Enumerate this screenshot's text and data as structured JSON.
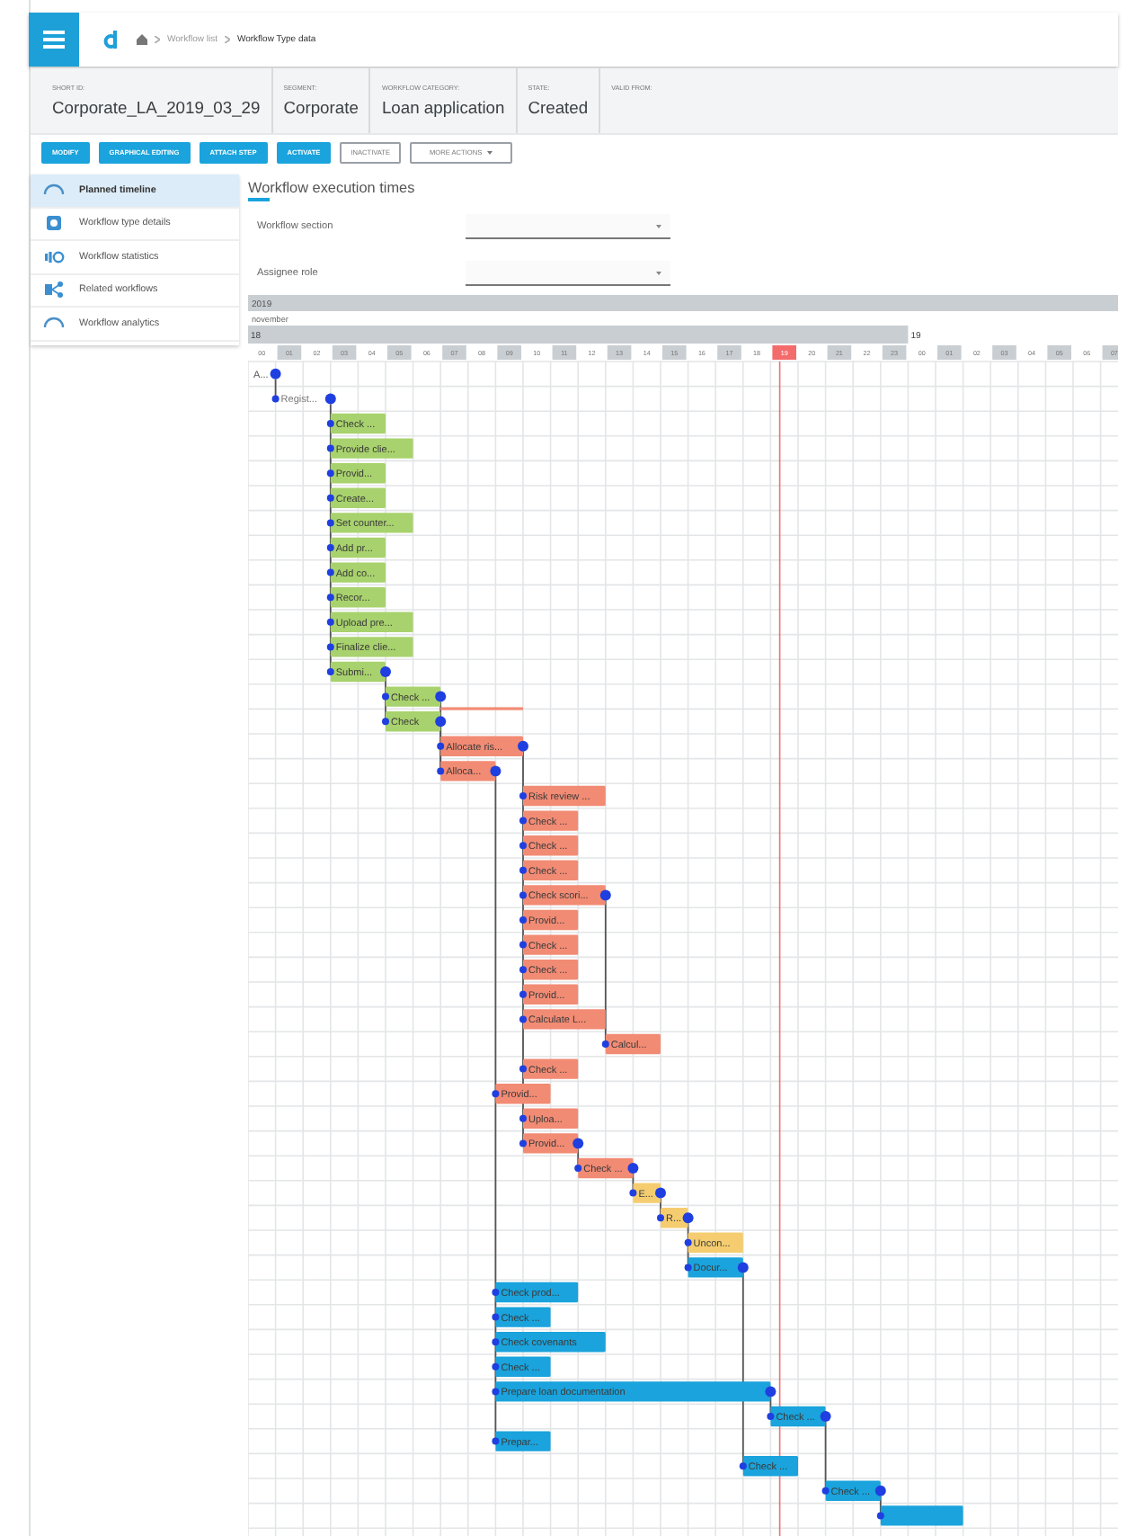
{
  "topbar": {
    "breadcrumb": [
      "Workflow list",
      "Workflow Type data"
    ]
  },
  "details": [
    {
      "label": "SHORT ID:",
      "value": "Corporate_LA_2019_03_29"
    },
    {
      "label": "SEGMENT:",
      "value": "Corporate"
    },
    {
      "label": "WORKFLOW CATEGORY:",
      "value": "Loan application"
    },
    {
      "label": "STATE:",
      "value": "Created"
    },
    {
      "label": "VALID FROM:"
    }
  ],
  "actions": [
    {
      "label": "MODIFY",
      "kind": "primary"
    },
    {
      "label": "GRAPHICAL EDITING",
      "kind": "primary"
    },
    {
      "label": "ATTACH STEP",
      "kind": "primary"
    },
    {
      "label": "ACTIVATE",
      "kind": "primary"
    },
    {
      "label": "INACTIVATE",
      "kind": "outline"
    },
    {
      "label": "MORE ACTIONS",
      "kind": "dropdown"
    }
  ],
  "sidebar": {
    "items": [
      {
        "label": "Planned timeline",
        "selected": true
      },
      {
        "label": "Workflow type details",
        "selected": false
      },
      {
        "label": "Workflow statistics",
        "selected": false
      },
      {
        "label": "Related workflows",
        "selected": false
      },
      {
        "label": "Workflow analytics",
        "selected": false
      }
    ]
  },
  "panel": {
    "title": "Workflow execution times",
    "filters": [
      {
        "label": "Workflow section"
      },
      {
        "label": "Assignee role"
      }
    ]
  },
  "gantt": {
    "year": "2019",
    "month": "november",
    "weeks": [
      {
        "label": "18",
        "current": true,
        "days": [
          {
            "label": "00",
            "today": false
          },
          {
            "label": "01",
            "today": false
          },
          {
            "label": "02",
            "today": false
          },
          {
            "label": "03",
            "today": false
          },
          {
            "label": "04",
            "today": false
          },
          {
            "label": "05",
            "today": false
          },
          {
            "label": "06",
            "today": false
          },
          {
            "label": "07",
            "today": false
          },
          {
            "label": "08",
            "today": false
          },
          {
            "label": "09",
            "today": false
          },
          {
            "label": "10",
            "today": false
          },
          {
            "label": "11",
            "today": false
          },
          {
            "label": "12",
            "today": false
          },
          {
            "label": "13",
            "today": false
          },
          {
            "label": "14",
            "today": false
          },
          {
            "label": "15",
            "today": false
          },
          {
            "label": "16",
            "today": false
          },
          {
            "label": "17",
            "today": false
          },
          {
            "label": "18",
            "today": false
          },
          {
            "label": "19",
            "today": true
          },
          {
            "label": "20",
            "today": false
          },
          {
            "label": "21",
            "today": false
          },
          {
            "label": "22",
            "today": false
          },
          {
            "label": "23",
            "today": false
          }
        ]
      },
      {
        "label": "19",
        "current": false,
        "days": [
          {
            "label": "00",
            "today": false
          },
          {
            "label": "01",
            "today": false
          },
          {
            "label": "02",
            "today": false
          },
          {
            "label": "03",
            "today": false
          },
          {
            "label": "04",
            "today": false
          },
          {
            "label": "05",
            "today": false
          },
          {
            "label": "06",
            "today": false
          },
          {
            "label": "07",
            "today": false
          }
        ]
      }
    ],
    "tasks": [
      {
        "kind": "milestone",
        "label": "A..."
      },
      {
        "kind": "plain",
        "label": "Regist..."
      },
      {
        "kind": "bar",
        "label": "Check ...",
        "color": "#a8d26d"
      },
      {
        "kind": "bar",
        "label": "Provide clie...",
        "color": "#a8d26d"
      },
      {
        "kind": "bar",
        "label": "Provid...",
        "color": "#a8d26d"
      },
      {
        "kind": "bar",
        "label": "Create...",
        "color": "#a8d26d"
      },
      {
        "kind": "bar",
        "label": "Set counter...",
        "color": "#a8d26d"
      },
      {
        "kind": "bar",
        "label": "Add pr...",
        "color": "#a8d26d"
      },
      {
        "kind": "bar",
        "label": "Add co...",
        "color": "#a8d26d"
      },
      {
        "kind": "bar",
        "label": "Recor...",
        "color": "#a8d26d"
      },
      {
        "kind": "bar",
        "label": "Upload pre...",
        "color": "#a8d26d"
      },
      {
        "kind": "bar",
        "label": "Finalize clie...",
        "color": "#a8d26d"
      },
      {
        "kind": "bar",
        "label": "Submi...",
        "color": "#a8d26d"
      },
      {
        "kind": "bar",
        "label": "Check ...",
        "color": "#a8d26d",
        "underline": {
          "color": "#f28b74"
        }
      },
      {
        "kind": "bar",
        "label": "Check",
        "color": "#a8d26d"
      },
      {
        "kind": "bar",
        "label": "Allocate ris...",
        "color": "#f28b74"
      },
      {
        "kind": "bar",
        "label": "Alloca...",
        "color": "#f28b74"
      },
      {
        "kind": "bar",
        "label": "Risk review ...",
        "color": "#f28b74"
      },
      {
        "kind": "bar",
        "label": "Check ...",
        "color": "#f28b74"
      },
      {
        "kind": "bar",
        "label": "Check ...",
        "color": "#f28b74"
      },
      {
        "kind": "bar",
        "label": "Check ...",
        "color": "#f28b74"
      },
      {
        "kind": "bar",
        "label": "Check scori...",
        "color": "#f28b74"
      },
      {
        "kind": "bar",
        "label": "Provid...",
        "color": "#f28b74"
      },
      {
        "kind": "bar",
        "label": "Check ...",
        "color": "#f28b74"
      },
      {
        "kind": "bar",
        "label": "Check ...",
        "color": "#f28b74"
      },
      {
        "kind": "bar",
        "label": "Provid...",
        "color": "#f28b74"
      },
      {
        "kind": "bar",
        "label": "Calculate L...",
        "color": "#f28b74"
      },
      {
        "kind": "bar",
        "label": "Calcul...",
        "color": "#f28b74"
      },
      {
        "kind": "bar",
        "label": "Check ...",
        "color": "#f28b74"
      },
      {
        "kind": "bar",
        "label": "Provid...",
        "color": "#f28b74"
      },
      {
        "kind": "bar",
        "label": "Uploa...",
        "color": "#f28b74"
      },
      {
        "kind": "bar",
        "label": "Provid...",
        "color": "#f28b74"
      },
      {
        "kind": "bar",
        "label": "Check ...",
        "color": "#f28b74"
      },
      {
        "kind": "bar",
        "label": "E...",
        "color": "#f5cd70"
      },
      {
        "kind": "bar",
        "label": "R...",
        "color": "#f5cd70"
      },
      {
        "kind": "bar",
        "label": "Uncon...",
        "color": "#f5cd70"
      },
      {
        "kind": "bar",
        "label": "Docur...",
        "color": "#1aa3dc"
      },
      {
        "kind": "bar",
        "label": "Check prod...",
        "color": "#1aa3dc"
      },
      {
        "kind": "bar",
        "label": "Check ...",
        "color": "#1aa3dc"
      },
      {
        "kind": "bar",
        "label": "Check covenants",
        "color": "#1aa3dc"
      },
      {
        "kind": "bar",
        "label": "Check ...",
        "color": "#1aa3dc"
      },
      {
        "kind": "bar",
        "label": "Prepare loan documentation",
        "color": "#1aa3dc"
      },
      {
        "kind": "bar",
        "label": "Check ...",
        "color": "#1aa3dc"
      },
      {
        "kind": "bar",
        "label": "Prepar...",
        "color": "#1aa3dc"
      },
      {
        "kind": "bar",
        "label": "Check ...",
        "color": "#1aa3dc"
      },
      {
        "kind": "bar",
        "label": "Check ...",
        "color": "#1aa3dc"
      },
      {
        "kind": "bar",
        "color": "#1aa3dc"
      }
    ]
  }
}
